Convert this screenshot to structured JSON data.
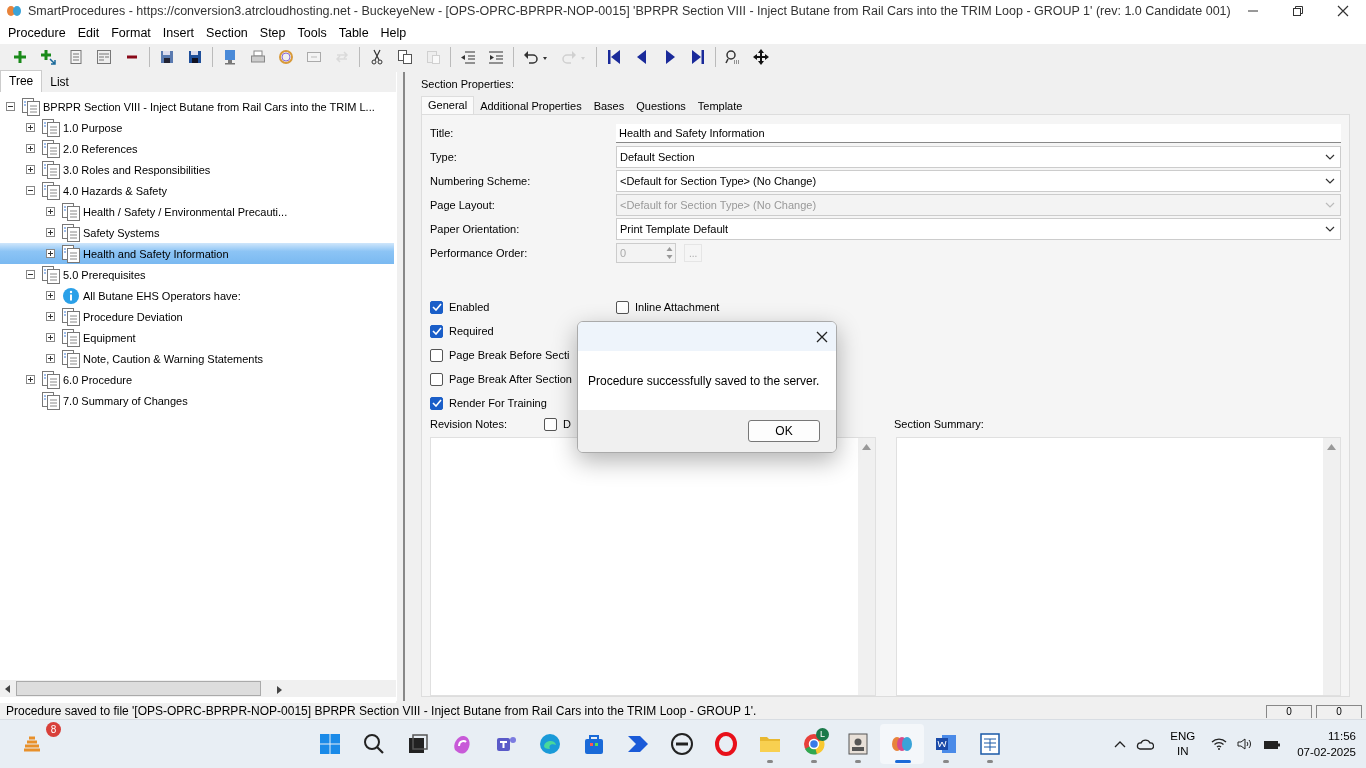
{
  "window": {
    "title": "SmartProcedures - https://conversion3.atrcloudhosting.net - BuckeyeNew - [OPS-OPRC-BPRPR-NOP-0015] 'BPRPR Section VIII - Inject Butane from Rail Cars into the TRIM Loop - GROUP 1' (rev: 1.0 Candidate 001)"
  },
  "menu": [
    "Procedure",
    "Edit",
    "Format",
    "Insert",
    "Section",
    "Step",
    "Tools",
    "Table",
    "Help"
  ],
  "toolbar": [
    {
      "kind": "add",
      "disabled": false
    },
    {
      "kind": "add-child",
      "disabled": false
    },
    {
      "kind": "list",
      "disabled": false
    },
    {
      "kind": "form",
      "disabled": false
    },
    {
      "kind": "remove",
      "disabled": false
    },
    {
      "kind": "sep"
    },
    {
      "kind": "save-server",
      "disabled": false
    },
    {
      "kind": "save",
      "disabled": false
    },
    {
      "kind": "sep"
    },
    {
      "kind": "monitor",
      "disabled": false
    },
    {
      "kind": "printer",
      "disabled": false
    },
    {
      "kind": "ring",
      "disabled": false
    },
    {
      "kind": "frame",
      "disabled": false
    },
    {
      "kind": "arrows",
      "disabled": true
    },
    {
      "kind": "sep"
    },
    {
      "kind": "cut",
      "disabled": false
    },
    {
      "kind": "copy",
      "disabled": false
    },
    {
      "kind": "paste",
      "disabled": true
    },
    {
      "kind": "sep"
    },
    {
      "kind": "outdent",
      "disabled": false
    },
    {
      "kind": "indent",
      "disabled": false
    },
    {
      "kind": "sep"
    },
    {
      "kind": "undo",
      "disabled": false
    },
    {
      "kind": "redo",
      "disabled": true
    },
    {
      "kind": "sep"
    },
    {
      "kind": "first",
      "disabled": false
    },
    {
      "kind": "prev",
      "disabled": false
    },
    {
      "kind": "next",
      "disabled": false
    },
    {
      "kind": "last",
      "disabled": false
    },
    {
      "kind": "sep"
    },
    {
      "kind": "find",
      "disabled": false
    },
    {
      "kind": "move",
      "disabled": false
    }
  ],
  "left_tabs": [
    {
      "label": "Tree",
      "selected": true
    },
    {
      "label": "List",
      "selected": false
    }
  ],
  "tree": [
    {
      "label": "BPRPR Section VIII - Inject Butane from Rail Cars into the TRIM L...",
      "kind": "page",
      "expanded": true,
      "selected": false,
      "children": [
        {
          "label": "1.0 Purpose",
          "kind": "page",
          "expanded": false,
          "selected": false
        },
        {
          "label": "2.0 References",
          "kind": "page",
          "expanded": false,
          "selected": false
        },
        {
          "label": "3.0 Roles and Responsibilities",
          "kind": "page",
          "expanded": false,
          "selected": false
        },
        {
          "label": "4.0 Hazards & Safety",
          "kind": "page",
          "expanded": true,
          "selected": false,
          "children": [
            {
              "label": "Health / Safety / Environmental Precauti...",
              "kind": "page",
              "expanded": false,
              "selected": false
            },
            {
              "label": "Safety Systems",
              "kind": "page",
              "expanded": false,
              "selected": false
            },
            {
              "label": "Health and Safety Information",
              "kind": "page",
              "expanded": false,
              "selected": true
            }
          ]
        },
        {
          "label": "5.0 Prerequisites",
          "kind": "page",
          "expanded": true,
          "selected": false,
          "children": [
            {
              "label": "All Butane EHS Operators have:",
              "kind": "info",
              "expanded": false,
              "selected": false
            },
            {
              "label": "Procedure Deviation",
              "kind": "page",
              "expanded": false,
              "selected": false
            },
            {
              "label": "Equipment",
              "kind": "page",
              "expanded": false,
              "selected": false
            },
            {
              "label": "Note, Caution & Warning Statements",
              "kind": "page",
              "expanded": false,
              "selected": false
            }
          ]
        },
        {
          "label": "6.0 Procedure",
          "kind": "page",
          "expanded": false,
          "selected": false
        },
        {
          "label": "7.0 Summary of Changes",
          "kind": "page",
          "selected": false
        }
      ]
    }
  ],
  "panel": {
    "heading": "Section Properties:",
    "tabs": [
      {
        "label": "General",
        "selected": true
      },
      {
        "label": "Additional Properties",
        "selected": false
      },
      {
        "label": "Bases",
        "selected": false
      },
      {
        "label": "Questions",
        "selected": false
      },
      {
        "label": "Template",
        "selected": false
      }
    ],
    "fields": [
      {
        "label": "Title:",
        "kind": "text",
        "value": "Health and Safety Information",
        "disabled": false
      },
      {
        "label": "Type:",
        "kind": "select",
        "value": "Default Section",
        "disabled": false
      },
      {
        "label": "Numbering Scheme:",
        "kind": "select",
        "value": "<Default for Section Type> (No Change)",
        "disabled": false
      },
      {
        "label": "Page Layout:",
        "kind": "select",
        "value": "<Default for Section Type> (No Change)",
        "disabled": true
      },
      {
        "label": "Paper Orientation:",
        "kind": "select",
        "value": "Print Template Default",
        "disabled": false
      },
      {
        "label": "Performance Order:",
        "kind": "spin",
        "value": "0",
        "disabled": true,
        "button": "..."
      }
    ],
    "checks_left": [
      {
        "label": "Enabled",
        "checked": true
      },
      {
        "label": "Required",
        "checked": true
      },
      {
        "label": "Page Break Before Secti",
        "checked": false
      },
      {
        "label": "Page Break After Section",
        "checked": false
      },
      {
        "label": "Render For Training",
        "checked": true
      }
    ],
    "checks_right": [
      {
        "label": "Inline Attachment",
        "checked": false
      }
    ],
    "revision_notes": {
      "label": "Revision Notes:",
      "check": {
        "label": "D",
        "checked": false
      }
    },
    "section_summary": {
      "label": "Section Summary:"
    }
  },
  "dialog": {
    "message": "Procedure successfully saved to the server.",
    "button": "OK"
  },
  "status_bar": {
    "text": "Procedure saved to file '[OPS-OPRC-BPRPR-NOP-0015] BPRPR Section VIII - Inject Butane from Rail Cars into the TRIM Loop - GROUP 1'.",
    "cells": [
      "0",
      "0"
    ]
  },
  "taskbar": {
    "widget_badge": "8",
    "apps": [
      {
        "kind": "start",
        "running": false,
        "active": false
      },
      {
        "kind": "search",
        "running": false,
        "active": false
      },
      {
        "kind": "taskview",
        "running": false,
        "active": false
      },
      {
        "kind": "copilot",
        "running": false,
        "active": false
      },
      {
        "kind": "teams",
        "running": false,
        "active": false
      },
      {
        "kind": "edge",
        "running": false,
        "active": false
      },
      {
        "kind": "store",
        "running": false,
        "active": false
      },
      {
        "kind": "automate",
        "running": false,
        "active": false
      },
      {
        "kind": "dell",
        "running": false,
        "active": false
      },
      {
        "kind": "opera",
        "running": false,
        "active": false
      },
      {
        "kind": "folder",
        "running": true,
        "active": false
      },
      {
        "kind": "chrome",
        "running": true,
        "active": false,
        "badge": "L"
      },
      {
        "kind": "contact",
        "running": true,
        "active": false
      },
      {
        "kind": "smart",
        "running": true,
        "active": true
      },
      {
        "kind": "word",
        "running": true,
        "active": false
      },
      {
        "kind": "doc",
        "running": true,
        "active": false
      }
    ],
    "language": "ENG",
    "region": "IN",
    "time": "11:56",
    "date": "07-02-2025"
  }
}
